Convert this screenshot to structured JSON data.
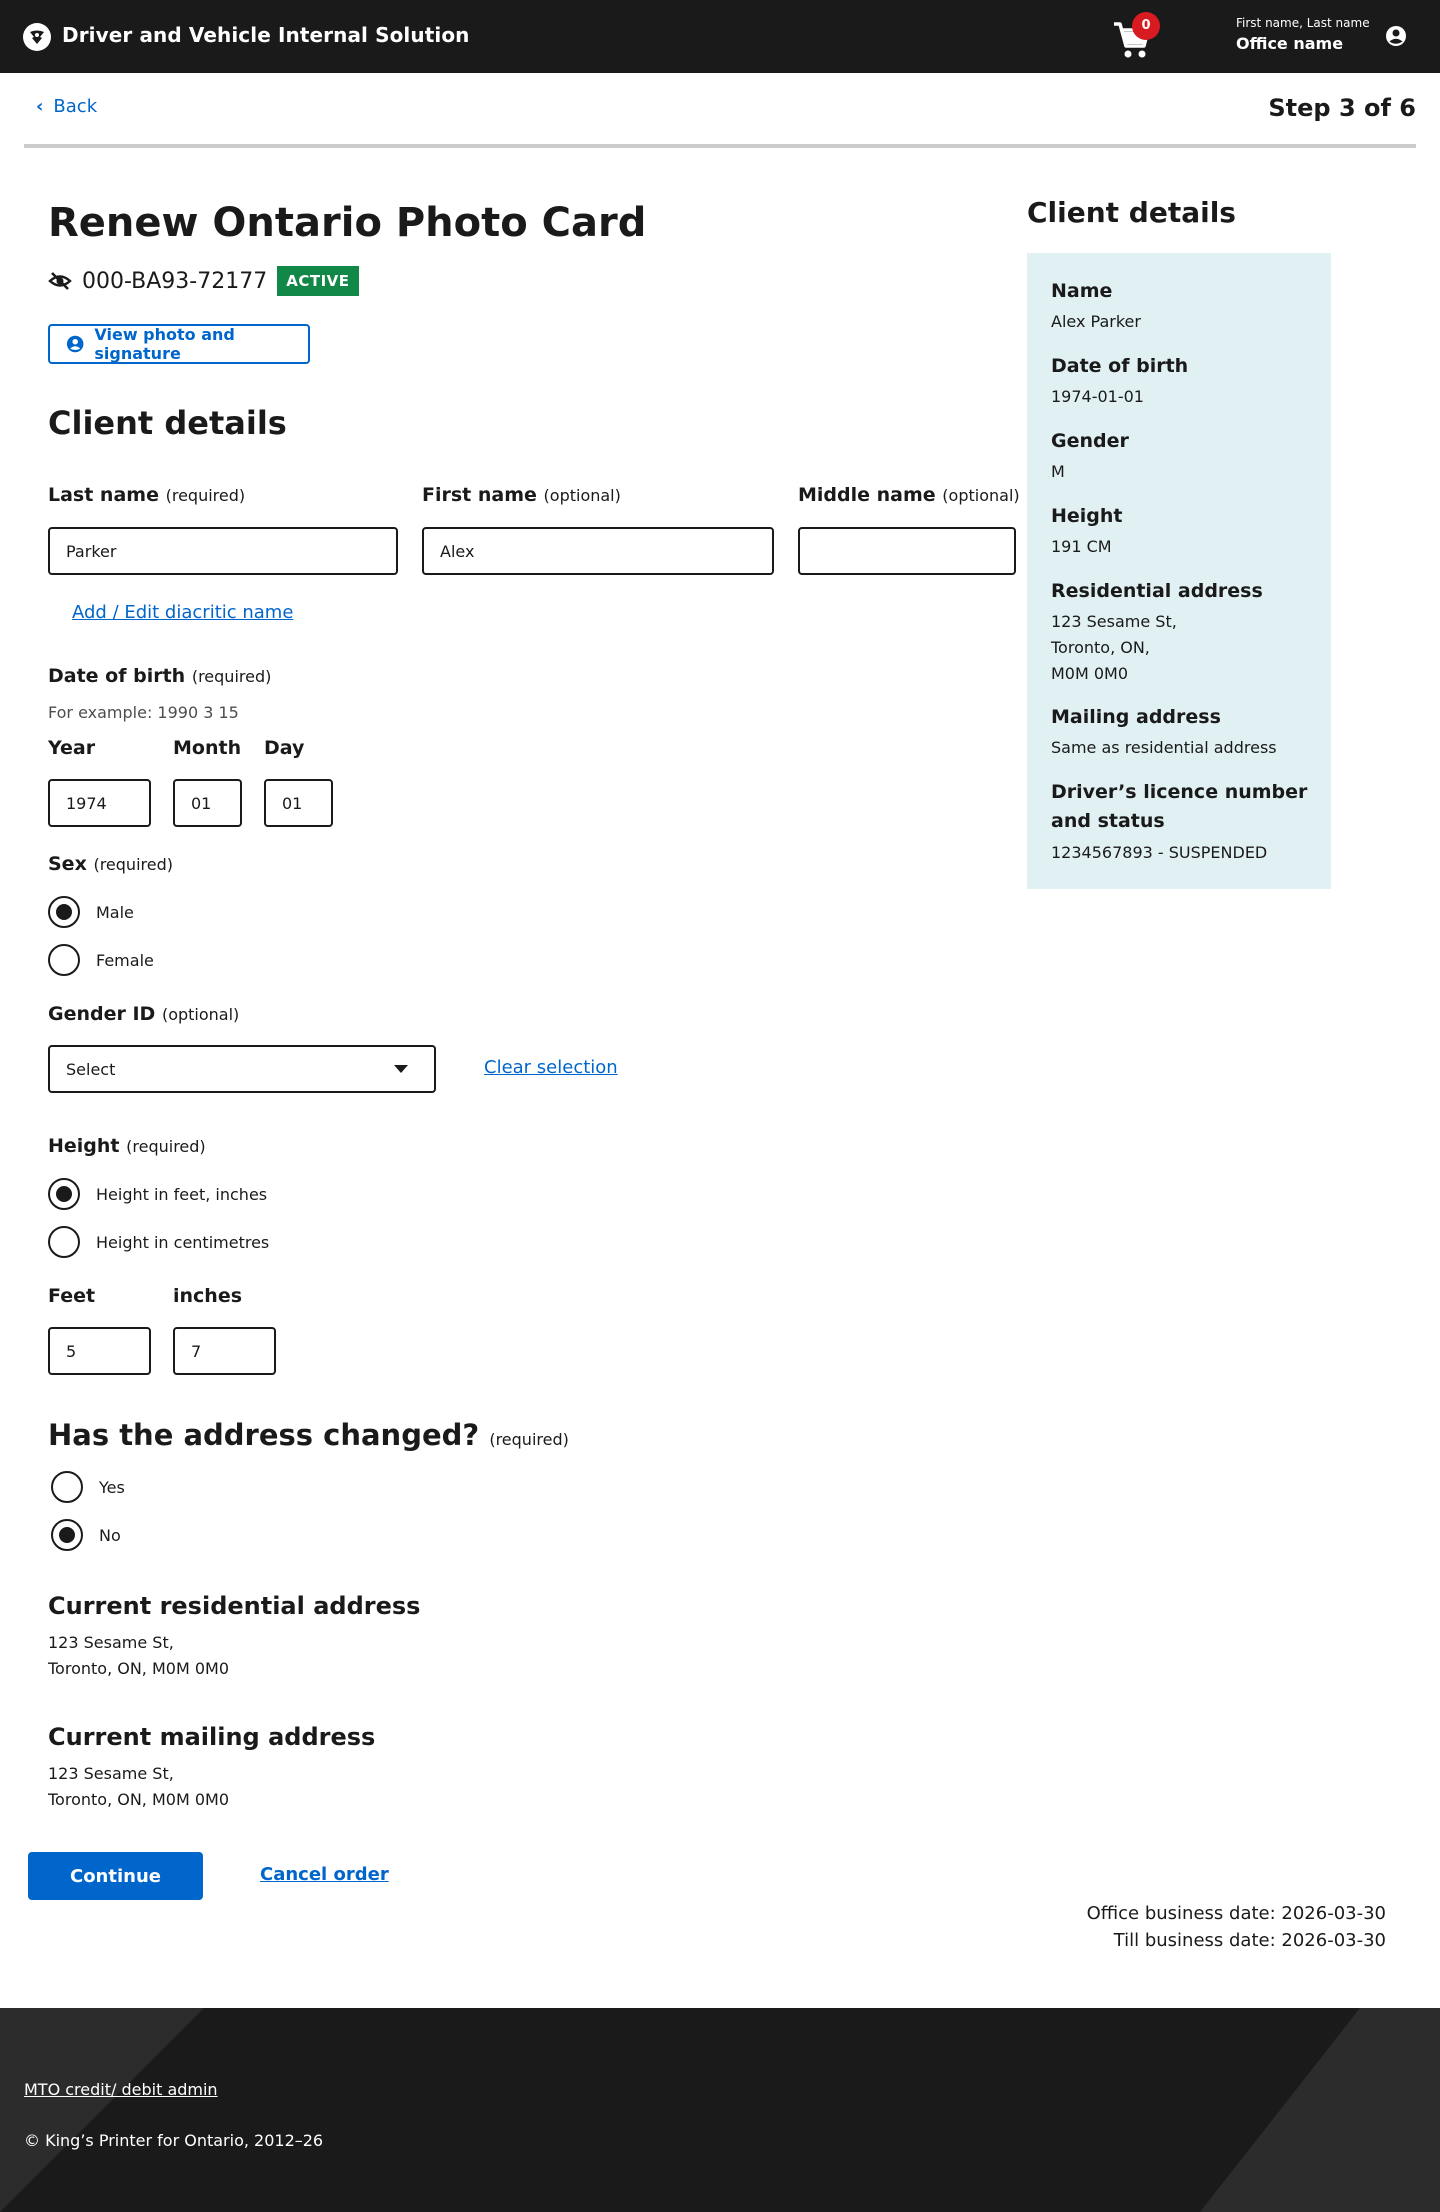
{
  "header": {
    "app_title": "Driver and Vehicle Internal Solution",
    "cart_count": "0",
    "user_name": "First name, Last name",
    "office_name": "Office name"
  },
  "nav": {
    "back_label": "Back",
    "step_label": "Step 3 of 6"
  },
  "page": {
    "title": "Renew Ontario Photo Card",
    "card_number": "000-BA93-72177",
    "card_status": "ACTIVE",
    "view_photo_label": "View photo and signature",
    "section_title": "Client details"
  },
  "form": {
    "last_name": {
      "label": "Last name",
      "req": "(required)",
      "value": "Parker"
    },
    "first_name": {
      "label": "First name",
      "req": "(optional)",
      "value": "Alex"
    },
    "middle_name": {
      "label": "Middle name",
      "req": "(optional)",
      "value": ""
    },
    "diacritic_link": "Add / Edit diacritic name",
    "dob": {
      "label": "Date of birth",
      "req": "(required)",
      "hint": "For example: 1990 3 15",
      "year_label": "Year",
      "year": "1974",
      "month_label": "Month",
      "month": "01",
      "day_label": "Day",
      "day": "01"
    },
    "sex": {
      "label": "Sex",
      "req": "(required)",
      "options": [
        "Male",
        "Female"
      ],
      "selected": "Male"
    },
    "gender_id": {
      "label": "Gender ID",
      "req": "(optional)",
      "selected": "Select",
      "clear_label": "Clear selection"
    },
    "height": {
      "label": "Height",
      "req": "(required)",
      "options": [
        "Height in feet, inches",
        "Height in centimetres"
      ],
      "selected": "Height in feet, inches",
      "feet_label": "Feet",
      "feet": "5",
      "inches_label": "inches",
      "inches": "7"
    },
    "address_changed": {
      "label": "Has the address changed?",
      "req": "(required)",
      "options": [
        "Yes",
        "No"
      ],
      "selected": "No"
    },
    "residential": {
      "title": "Current residential address",
      "line1": "123 Sesame St,",
      "line2": "Toronto, ON, M0M 0M0"
    },
    "mailing": {
      "title": "Current mailing address",
      "line1": "123 Sesame St,",
      "line2": "Toronto, ON, M0M 0M0"
    },
    "continue_label": "Continue",
    "cancel_label": "Cancel order"
  },
  "business_dates": {
    "office": "Office business date: 2026-03-30",
    "till": "Till business date: 2026-03-30"
  },
  "sidebar": {
    "title": "Client details",
    "name_label": "Name",
    "name": "Alex Parker",
    "dob_label": "Date of birth",
    "dob": "1974-01-01",
    "gender_label": "Gender",
    "gender": "M",
    "height_label": "Height",
    "height": "191 CM",
    "res_label": "Residential address",
    "res_line1": "123 Sesame St,",
    "res_line2": "Toronto, ON,",
    "res_line3": "M0M 0M0",
    "mail_label": "Mailing address",
    "mail": "Same as residential address",
    "licence_label_1": "Driver’s licence number",
    "licence_label_2": "and status",
    "licence": "1234567893 - SUSPENDED"
  },
  "footer": {
    "link": "MTO credit/ debit admin",
    "copyright": "© King’s Printer for Ontario, 2012–26"
  },
  "colors": {
    "brand_blue": "#0066cc",
    "header_bg": "#1a1a1a",
    "active_green": "#118847",
    "badge_red": "#d81a21",
    "panel_bg": "#e0f0f3"
  }
}
